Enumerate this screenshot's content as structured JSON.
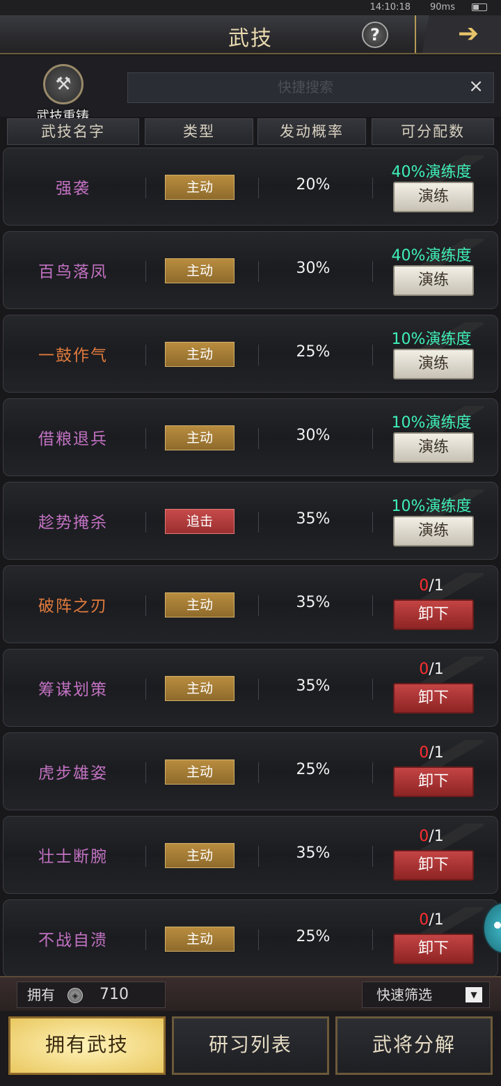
{
  "status": {
    "time": "14:10:18",
    "net": "90ms"
  },
  "header": {
    "title": "武技",
    "help": "?"
  },
  "top": {
    "reforge_label": "武技重铸",
    "search_placeholder": "快捷搜索",
    "clear": "×"
  },
  "columns": [
    "武技名字",
    "类型",
    "发动概率",
    "可分配数"
  ],
  "skills": [
    {
      "name": "强袭",
      "name_color": "#c272c2",
      "type": "主动",
      "type_kind": "active",
      "rate": "20%",
      "status": "40%演练度",
      "action": "演练",
      "action_kind": "practice"
    },
    {
      "name": "百鸟落凤",
      "name_color": "#c272c2",
      "type": "主动",
      "type_kind": "active",
      "rate": "30%",
      "status": "40%演练度",
      "action": "演练",
      "action_kind": "practice"
    },
    {
      "name": "一鼓作气",
      "name_color": "#e07a3c",
      "type": "主动",
      "type_kind": "active",
      "rate": "25%",
      "status": "10%演练度",
      "action": "演练",
      "action_kind": "practice"
    },
    {
      "name": "借粮退兵",
      "name_color": "#c272c2",
      "type": "主动",
      "type_kind": "active",
      "rate": "30%",
      "status": "10%演练度",
      "action": "演练",
      "action_kind": "practice"
    },
    {
      "name": "趁势掩杀",
      "name_color": "#c272c2",
      "type": "追击",
      "type_kind": "pursuit",
      "rate": "35%",
      "status": "10%演练度",
      "action": "演练",
      "action_kind": "practice"
    },
    {
      "name": "破阵之刃",
      "name_color": "#e07a3c",
      "type": "主动",
      "type_kind": "active",
      "rate": "35%",
      "slot_used": "0",
      "slot_total": "/1",
      "action": "卸下",
      "action_kind": "unload"
    },
    {
      "name": "筹谋划策",
      "name_color": "#c272c2",
      "type": "主动",
      "type_kind": "active",
      "rate": "35%",
      "slot_used": "0",
      "slot_total": "/1",
      "action": "卸下",
      "action_kind": "unload"
    },
    {
      "name": "虎步雄姿",
      "name_color": "#c272c2",
      "type": "主动",
      "type_kind": "active",
      "rate": "25%",
      "slot_used": "0",
      "slot_total": "/1",
      "action": "卸下",
      "action_kind": "unload"
    },
    {
      "name": "壮士断腕",
      "name_color": "#c272c2",
      "type": "主动",
      "type_kind": "active",
      "rate": "35%",
      "slot_used": "0",
      "slot_total": "/1",
      "action": "卸下",
      "action_kind": "unload"
    },
    {
      "name": "不战自溃",
      "name_color": "#c272c2",
      "type": "主动",
      "type_kind": "active",
      "rate": "25%",
      "slot_used": "0",
      "slot_total": "/1",
      "action": "卸下",
      "action_kind": "unload"
    }
  ],
  "bottom": {
    "owned_label": "拥有",
    "owned_value": "710",
    "filter_label": "快速筛选"
  },
  "tabs": [
    {
      "label": "拥有武技",
      "active": true
    },
    {
      "label": "研习列表",
      "active": false
    },
    {
      "label": "武将分解",
      "active": false
    }
  ]
}
